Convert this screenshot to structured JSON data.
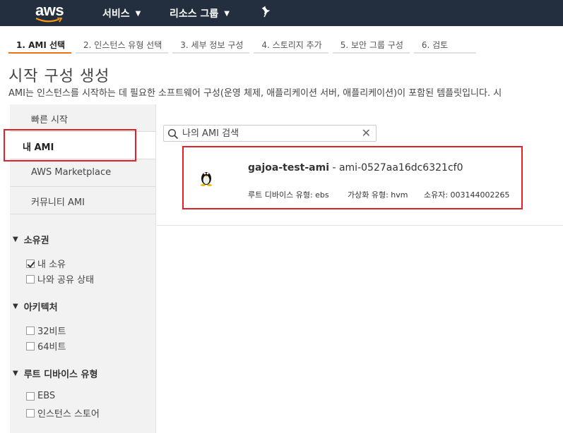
{
  "topnav": {
    "logo": "aws",
    "services": "서비스",
    "resource_groups": "리소스 그룹"
  },
  "steps": [
    "1. AMI 선택",
    "2. 인스턴스 유형 선택",
    "3. 세부 정보 구성",
    "4. 스토리지 추가",
    "5. 보안 그룹 구성",
    "6. 검토"
  ],
  "page": {
    "title": "시작 구성 생성",
    "description": "AMI는 인스턴스를 시작하는 데 필요한 소프트웨어 구성(운영 체제, 애플리케이션 서버, 애플리케이션)이 포함된 템플릿입니다. 시"
  },
  "leftnav": {
    "items": [
      "빠른 시작",
      "내 AMI",
      "AWS Marketplace",
      "커뮤니티 AMI"
    ],
    "filters": {
      "ownership": {
        "label": "소유권",
        "options": [
          "내 소유",
          "나와 공유 상태"
        ]
      },
      "architecture": {
        "label": "아키텍처",
        "options": [
          "32비트",
          "64비트"
        ]
      },
      "root_device": {
        "label": "루트 디바이스 유형",
        "options": [
          "EBS",
          "인스턴스 스토어"
        ]
      }
    }
  },
  "search": {
    "placeholder": "나의 AMI 검색"
  },
  "ami": {
    "name": "gajoa-test-ami",
    "id": " - ami-0527aa16dc6321cf0",
    "root_device": "루트 디바이스 유형: ebs",
    "virtualization": "가상화 유형: hvm",
    "owner": "소유자: 003144002265"
  },
  "colors": {
    "nav_bg": "#232f3e",
    "accent": "#ec7211",
    "highlight": "#e0202a"
  }
}
